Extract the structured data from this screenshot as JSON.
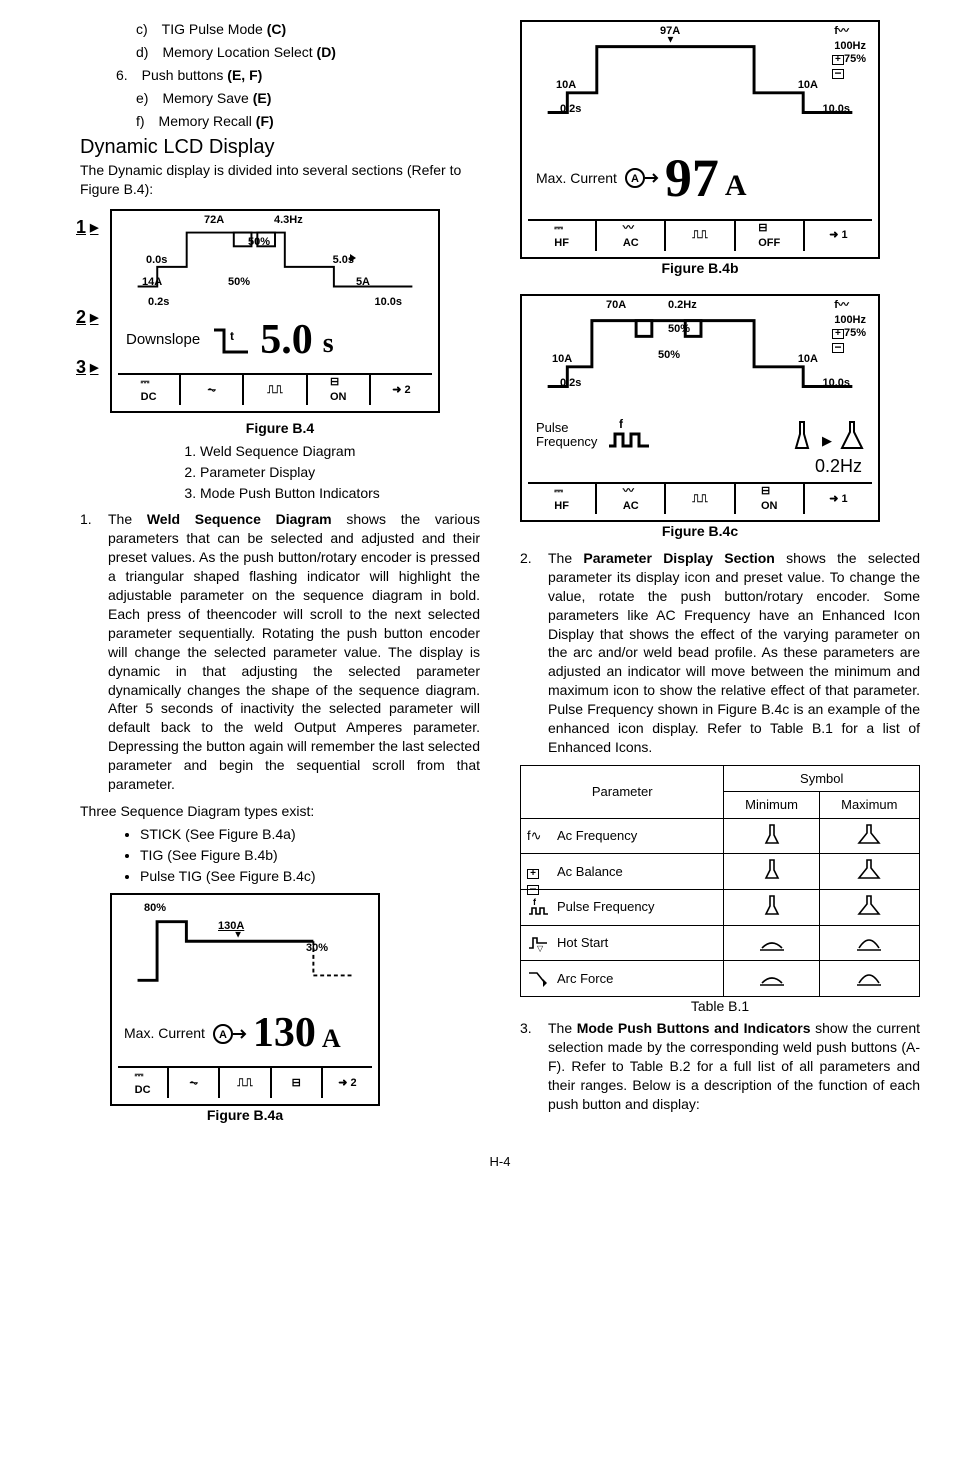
{
  "header": {
    "c": "c) TIG Pulse Mode ",
    "c_bold": "(C)",
    "d": "d) Memory Location Select ",
    "d_bold": "(D)",
    "six": "6. Push buttons ",
    "six_bold": "(E, F)",
    "e": "e) Memory Save ",
    "e_bold": "(E)",
    "f": "f) Memory Recall ",
    "f_bold": "(F)"
  },
  "dynamic_heading": "Dynamic LCD Display",
  "dynamic_intro": "The Dynamic display is divided into several sections (Refer to Figure B.4):",
  "figB4": {
    "caption": "Figure B.4",
    "items": [
      "Weld Sequence Diagram",
      "Parameter Display",
      "Mode Push Button Indicators"
    ],
    "labels": {
      "top_current": "72A",
      "freq": "4.3Hz",
      "duty1": "50%",
      "t0": "0.0s",
      "t5": "5.0s",
      "i_start": "14A",
      "duty2": "50%",
      "i_end": "5A",
      "t02": "0.2s",
      "t10": "10.0s",
      "param_name": "Downslope",
      "param_val": "5.0",
      "param_unit": "s",
      "row": [
        "⎓\nDC",
        "⏦",
        "⎍⎍",
        "⊟\nON",
        "➜ 2"
      ]
    }
  },
  "weld_seq_para": {
    "num": "1.",
    "pre": "The ",
    "bold": "Weld Sequence Diagram",
    "post": " shows the various parameters that can be selected and adjusted and their preset values.  As the push button/rotary encoder is pressed a triangular shaped flashing indicator will highlight the adjustable parameter on the sequence diagram in bold.  Each press of theencoder will scroll to the next selected parameter sequentially.  Rotating the push button encoder will change the selected parameter value.  The display is dynamic in that adjusting the selected parameter dynamically changes the shape of the sequence diagram.  After 5 seconds of inactivity the selected parameter will default back to the weld Output Amperes parameter.  Depressing the button again will remember the last selected parameter and begin the sequential scroll from that parameter."
  },
  "seq_types_intro": "Three Sequence Diagram types exist:",
  "seq_types": [
    "STICK (See Figure B.4a)",
    "TIG (See Figure B.4b)",
    "Pulse TIG (See Figure B.4c)"
  ],
  "figB4a": {
    "caption": "Figure B.4a",
    "labels": {
      "pct80": "80%",
      "a130": "130A",
      "pct30": "30%",
      "param_name": "Max. Current",
      "val": "130",
      "unit": "A",
      "row": [
        "⎓\nDC",
        "⏦",
        "⎍⎍",
        "⊟",
        "➜ 2"
      ]
    }
  },
  "figB4b": {
    "caption": "Figure B.4b",
    "labels": {
      "top": "97A",
      "i10a": "10A",
      "i10b": "10A",
      "t02": "0.2s",
      "t10": "10.0s",
      "f100": "100Hz",
      "pct75": "75%",
      "param_name": "Max. Current",
      "val": "97",
      "unit": "A",
      "row": [
        "⎓\nHF",
        "〰\nAC",
        "⎍⎍",
        "⊟\nOFF",
        "➜ 1"
      ]
    }
  },
  "figB4c": {
    "caption": "Figure B.4c",
    "labels": {
      "top": "70A",
      "hz02": "0.2Hz",
      "f100": "100Hz",
      "pct75": "75%",
      "pct50a": "50%",
      "pct50b": "50%",
      "i10a": "10A",
      "i10b": "10A",
      "t02": "0.2s",
      "t10": "10.0s",
      "param_name": "Pulse\nFrequency",
      "freq_readout": "0.2Hz",
      "row": [
        "⎓\nHF",
        "〰\nAC",
        "⎍⎍",
        "⊟\nON",
        "➜ 1"
      ]
    }
  },
  "param_section_para": {
    "num": "2.",
    "pre": "The ",
    "bold": "Parameter Display Section",
    "post": " shows the selected parameter its display icon and preset value.  To change the value, rotate the push button/rotary encoder.  Some parameters like AC Frequency have an Enhanced Icon Display that shows the effect of the varying parameter on the arc and/or weld bead profile.  As these parameters are adjusted an indicator will move between the minimum and maximum icon to show the relative effect of that parameter.  Pulse Frequency shown in Figure B.4c is an example of the enhanced icon display.  Refer to Table B.1 for a list of Enhanced Icons."
  },
  "table": {
    "head_param": "Parameter",
    "head_symbol": "Symbol",
    "head_min": "Minimum",
    "head_max": "Maximum",
    "rows": [
      {
        "name": "Ac Frequency",
        "icon": "f∿"
      },
      {
        "name": "Ac Balance",
        "icon": "±"
      },
      {
        "name": "Pulse Frequency",
        "icon": "f⎍⎍"
      },
      {
        "name": "Hot Start",
        "icon": "⎍▽"
      },
      {
        "name": "Arc Force",
        "icon": "▷"
      }
    ],
    "caption": "Table B.1"
  },
  "mode_push_para": {
    "num": "3.",
    "pre": "The ",
    "bold": "Mode Push Buttons and Indicators",
    "post": " show the current selection made by the corresponding weld push buttons (A-F).  Refer to Table B.2 for a full list of all parameters and their ranges.  Below is a description of the function of each push button and display:"
  },
  "footer": "H-4",
  "chart_data": [
    {
      "type": "line",
      "name": "Figure B.4 weld sequence",
      "annotations": {
        "peak_current": "72A",
        "start_current": "14A",
        "end_current": "5A",
        "pre_flow": "0.0s",
        "up_time": "0.2s",
        "top_time": "5.0s",
        "down_time": "10.0s",
        "freq": "4.3Hz",
        "duty": "50%"
      },
      "parameter_display": {
        "name": "Downslope",
        "value": 5.0,
        "unit": "s"
      }
    },
    {
      "type": "line",
      "name": "Figure B.4a STICK",
      "annotations": {
        "hot_start_pct": "80%",
        "peak_current": "130A",
        "arc_force_pct": "30%"
      },
      "parameter_display": {
        "name": "Max. Current",
        "value": 130,
        "unit": "A"
      }
    },
    {
      "type": "line",
      "name": "Figure B.4b TIG",
      "annotations": {
        "peak_current": "97A",
        "start_current": "10A",
        "end_current": "10A",
        "up_time": "0.2s",
        "down_time": "10.0s",
        "ac_freq": "100Hz",
        "ac_balance": "75%"
      },
      "parameter_display": {
        "name": "Max. Current",
        "value": 97,
        "unit": "A"
      }
    },
    {
      "type": "line",
      "name": "Figure B.4c Pulse TIG",
      "annotations": {
        "peak_current": "70A",
        "pulse_freq": "0.2Hz",
        "ac_freq": "100Hz",
        "ac_balance": "75%",
        "duty": "50%",
        "background_pct": "50%",
        "start_current": "10A",
        "end_current": "10A",
        "up_time": "0.2s",
        "down_time": "10.0s"
      },
      "parameter_display": {
        "name": "Pulse Frequency",
        "value": 0.2,
        "unit": "Hz"
      }
    }
  ]
}
